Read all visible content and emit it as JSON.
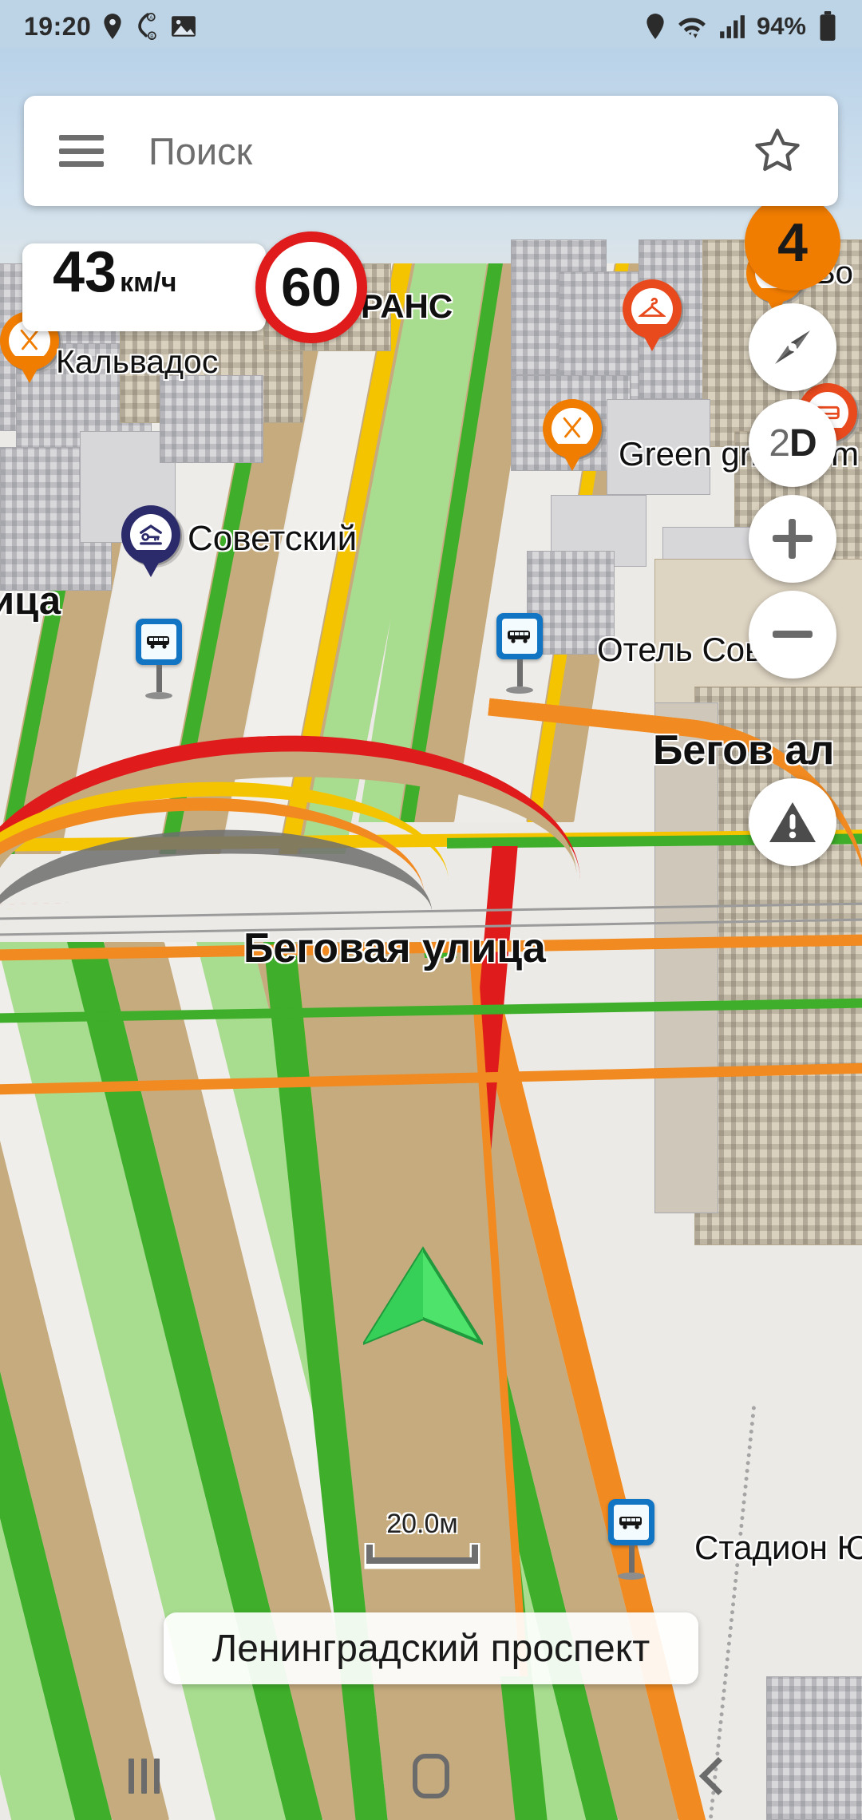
{
  "status_bar": {
    "time": "19:20",
    "left_icons": [
      "location-pin-icon",
      "navigation-ab-icon",
      "image-icon"
    ],
    "right_icons": [
      "location-pin-icon",
      "wifi-icon",
      "cellular-signal-icon"
    ],
    "battery_percent": "94%"
  },
  "search": {
    "placeholder": "Поиск",
    "menu_icon": "hamburger-menu-icon",
    "favorite_icon": "star-outline-icon"
  },
  "speed": {
    "current": "43",
    "unit": "км/ч",
    "limit": "60"
  },
  "map_controls": {
    "cluster_count": "4",
    "compass_label": "compass-icon",
    "view_mode_prefix": "2",
    "view_mode_suffix": "D",
    "zoom_in": "+",
    "zoom_out": "−",
    "alert_label": "warning-triangle-icon"
  },
  "map_labels": {
    "poi": [
      {
        "name": "Кальвадос",
        "icon": "restaurant-icon"
      },
      {
        "name": "Советский",
        "icon": "hotel-key-icon"
      },
      {
        "name": "Green grill room",
        "icon": "restaurant-icon"
      },
      {
        "name": "Во",
        "icon": "restaurant-icon"
      },
      {
        "name": "Отель Сов",
        "icon": "bus-stop-icon"
      },
      {
        "name": "Стадион Юн",
        "icon": "bus-stop-icon"
      }
    ],
    "streets": [
      {
        "name": "Беговая улица"
      },
      {
        "name": "Бегов    ал"
      },
      {
        "name": "ица"
      },
      {
        "name": "АТРАНС"
      }
    ],
    "current_street": "Ленинградский проспект",
    "scale": "20.0м"
  },
  "nav_bar": {
    "recents": "recents-button",
    "home": "home-button",
    "back": "back-button"
  },
  "colors": {
    "accent_orange": "#f07c00",
    "limit_red": "#e01b1b",
    "traffic_green": "#3fae2a",
    "traffic_yellow": "#f5c400",
    "traffic_orange": "#f18a20",
    "traffic_red": "#e01b1b",
    "road_fill": "#c6ab7e",
    "sign_blue": "#1275c4"
  }
}
